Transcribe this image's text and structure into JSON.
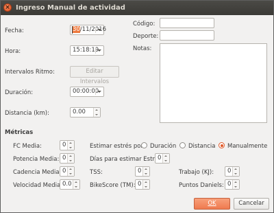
{
  "window": {
    "title": "Ingreso Manual de actividad",
    "close_symbol": "×"
  },
  "left": {
    "fecha": {
      "label": "Fecha:",
      "day": "30",
      "rest": "/11/2016"
    },
    "hora": {
      "label": "Hora:",
      "value": "15:18:19"
    },
    "intervalos": {
      "label": "Intervalos Ritmo:",
      "button": "Editar Intervalos"
    },
    "duracion": {
      "label": "Duración:",
      "value": "00:00:00"
    },
    "distancia": {
      "label": "Distancia (km):",
      "value": "0.00"
    }
  },
  "right": {
    "codigo": {
      "label": "Código:",
      "value": ""
    },
    "deporte": {
      "label": "Deporte:",
      "value": ""
    },
    "notas": {
      "label": "Notas:",
      "value": ""
    }
  },
  "metricas": {
    "title": "Métricas",
    "fc_media": {
      "label": "FC Media:",
      "value": "0"
    },
    "potencia_media": {
      "label": "Potencia Media:",
      "value": "0"
    },
    "cadencia_media": {
      "label": "Cadencia Media:",
      "value": "0"
    },
    "velocidad_media": {
      "label": "Velocidad Media:",
      "value": "0.0"
    },
    "estimar": {
      "label": "Estimar estrés por:",
      "options": [
        "Duración",
        "Distancia",
        "Manualmente"
      ],
      "selected": "Manualmente"
    },
    "dias": {
      "label": "Días para estimar Estrés:",
      "value": "0"
    },
    "tss": {
      "label": "TSS:",
      "value": "0"
    },
    "bikescore": {
      "label": "BikeScore (TM):",
      "value": "0"
    },
    "trabajo": {
      "label": "Trabajo (KJ):",
      "value": "0"
    },
    "puntos_daniels": {
      "label": "Puntos Daniels:",
      "value": "0"
    }
  },
  "buttons": {
    "ok": "OK",
    "cancel": "Cancelar"
  },
  "colors": {
    "accent": "#ef7a4f",
    "titlebar": "#3b3a36",
    "window_bg": "#f2f1f0"
  }
}
